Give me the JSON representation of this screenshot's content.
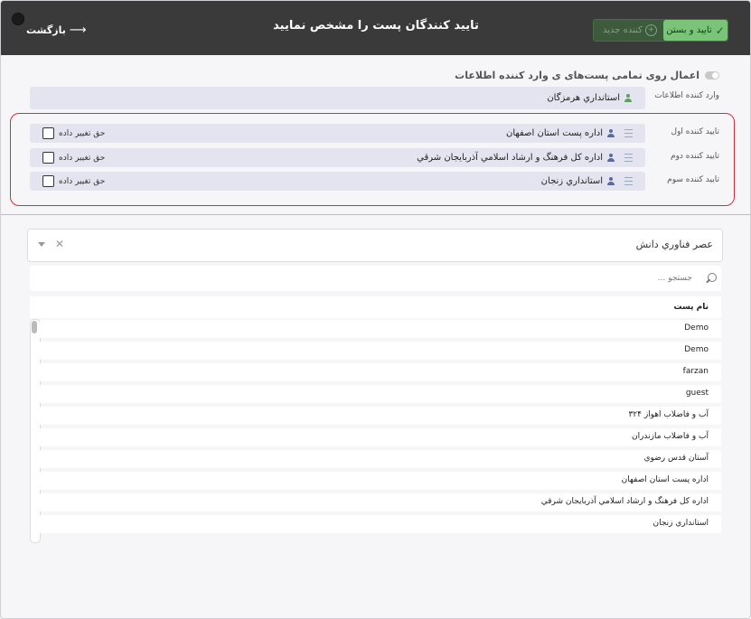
{
  "header": {
    "back_label": "بازگشت",
    "title": "تایید کنندگان پست را مشخص نمایید",
    "new_author_label": "کننده جدید",
    "confirm_close_label": "تایید و بستن"
  },
  "apply_all_label": "اعمال روی تمامی پست‌های ی وارد کننده اطلاعات",
  "entry": {
    "label": "وارد کننده اطلاعات",
    "value": "استانداري هرمزگان"
  },
  "approvers": [
    {
      "label": "تایید کننده اول",
      "value": "اداره پست استان اصفهان",
      "permission": "حق تغییر داده"
    },
    {
      "label": "تایید کننده دوم",
      "value": "اداره کل فرهنگ و ارشاد اسلامي آذربايجان شرقي",
      "permission": "حق تغییر داده"
    },
    {
      "label": "تایید کننده سوم",
      "value": "استانداري زنجان",
      "permission": "حق تغییر داده"
    }
  ],
  "org_select": {
    "value": "عصر فناوري دانش"
  },
  "search": {
    "placeholder": "جستجو ..."
  },
  "table": {
    "header": "نام پست",
    "rows": [
      "Demo",
      "Demo",
      "farzan",
      "guest",
      "آب و فاضلاب اهواز ۳۲۴",
      "آب و فاضلاب مازندران",
      "آستان قدس رضوي",
      "اداره پست استان اصفهان",
      "اداره کل فرهنگ و ارشاد اسلامي آذربايجان شرقي",
      "استانداري زنجان"
    ]
  },
  "colors": {
    "header_bg": "#3a3a3a",
    "confirm_green": "#7ac47a",
    "highlight_red": "#d32f3a",
    "pill_bg": "#e3e4ef",
    "user_icon_green": "#5aa05a",
    "user_icon_blue": "#5a6aa0"
  }
}
